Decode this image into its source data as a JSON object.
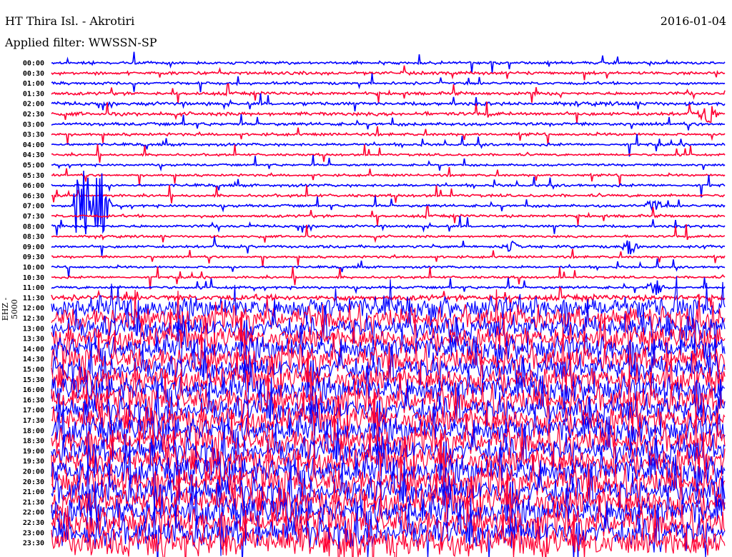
{
  "header": {
    "station": "HT Thira Isl. - Akrotiri",
    "date": "2016-01-04",
    "filter": "Applied filter: WWSSN-SP",
    "channel": "EHZ - 5000"
  },
  "chart_data": {
    "type": "line",
    "title": "HT Thira Isl. - Akrotiri",
    "subtitle": "Applied filter: WWSSN-SP",
    "ylabel": "EHZ - 5000",
    "minutes_per_line": 30,
    "colors": [
      "#0000ff",
      "#ff0033"
    ],
    "row_labels": [
      "00:00",
      "00:30",
      "01:00",
      "01:30",
      "02:00",
      "02:30",
      "03:00",
      "03:30",
      "04:00",
      "04:30",
      "05:00",
      "05:30",
      "06:00",
      "06:30",
      "07:00",
      "07:30",
      "08:00",
      "08:30",
      "09:00",
      "09:30",
      "10:00",
      "10:30",
      "11:00",
      "11:30",
      "12:00",
      "12:30",
      "13:00",
      "13:30",
      "14:00",
      "14:30",
      "15:00",
      "15:30",
      "16:00",
      "16:30",
      "17:00",
      "17:30",
      "18:00",
      "18:30",
      "19:00",
      "19:30",
      "20:00",
      "20:30",
      "21:00",
      "21:30",
      "22:00",
      "22:30",
      "23:00",
      "23:30"
    ],
    "noise_level": [
      0.3,
      0.35,
      0.3,
      0.35,
      0.4,
      0.4,
      0.35,
      0.3,
      0.3,
      0.25,
      0.25,
      0.25,
      0.3,
      0.3,
      0.3,
      0.3,
      0.3,
      0.25,
      0.3,
      0.25,
      0.25,
      0.25,
      0.3,
      0.6,
      2.5,
      2.5,
      2.6,
      2.6,
      2.8,
      2.8,
      2.8,
      2.8,
      3,
      3,
      3,
      3,
      3,
      3,
      3,
      3,
      3.2,
      3.2,
      3.2,
      3.2,
      3.2,
      3.2,
      3.2,
      3.2
    ],
    "events": [
      {
        "row": 14,
        "minute": 1.4,
        "amplitude": 8
      },
      {
        "row": 14,
        "minute": 2.2,
        "amplitude": 6
      },
      {
        "row": 18,
        "minute": 20.4,
        "amplitude": 1
      },
      {
        "row": 18,
        "minute": 25.7,
        "amplitude": 1
      },
      {
        "row": 14,
        "minute": 26.8,
        "amplitude": 0.8
      },
      {
        "row": 22,
        "minute": 26.9,
        "amplitude": 1
      },
      {
        "row": 5,
        "minute": 29.2,
        "amplitude": 1.5
      }
    ]
  }
}
